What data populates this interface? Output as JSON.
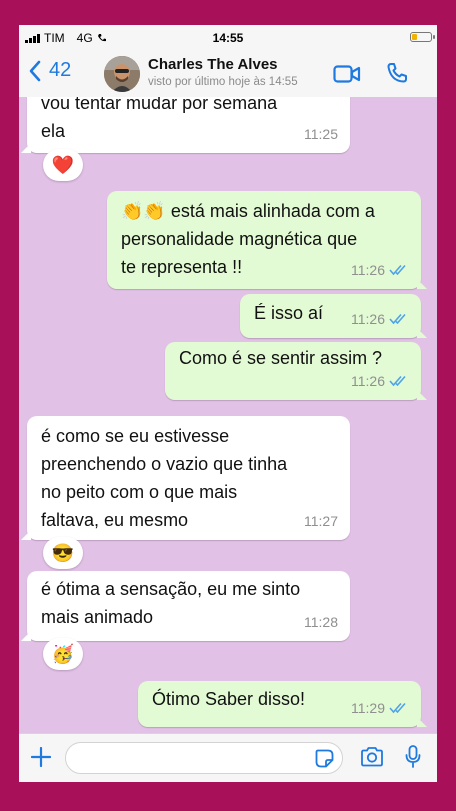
{
  "status_bar": {
    "carrier": "TIM",
    "network": "4G",
    "time": "14:55"
  },
  "header": {
    "back_count": "42",
    "contact_name": "Charles The Alves",
    "last_seen": "visto por último hoje às 14:55"
  },
  "messages": [
    {
      "direction": "in",
      "text": [
        "vou tentar mudar por semana",
        "ela"
      ],
      "time": "11:25",
      "reaction": "❤️"
    },
    {
      "direction": "out",
      "text": [
        "👏👏 está mais alinhada com a",
        "personalidade magnética que",
        "te representa !!"
      ],
      "time": "11:26",
      "status": "read"
    },
    {
      "direction": "out",
      "text": [
        "É isso aí"
      ],
      "time": "11:26",
      "status": "read"
    },
    {
      "direction": "out",
      "text": [
        "Como é se sentir assim ?"
      ],
      "time": "11:26",
      "status": "read"
    },
    {
      "direction": "in",
      "text": [
        "é como se eu estivesse",
        "preenchendo o vazio que tinha",
        "no peito com o que mais",
        "faltava, eu mesmo"
      ],
      "time": "11:27",
      "reaction": "😎"
    },
    {
      "direction": "in",
      "text": [
        "é ótima a sensação, eu me sinto",
        "mais animado"
      ],
      "time": "11:28",
      "reaction": "🥳"
    },
    {
      "direction": "out",
      "text": [
        "Ótimo Saber disso!"
      ],
      "time": "11:29",
      "status": "read"
    }
  ],
  "colors": {
    "accent": "#1f7ae0",
    "chat_background": "#e2c1e7",
    "outgoing_bubble": "#e3fbd4",
    "read_tick": "#4fa3e8",
    "frame": "#a8115a"
  },
  "composer": {
    "icons": [
      "plus-icon",
      "sticker-icon",
      "camera-icon",
      "microphone-icon"
    ]
  }
}
